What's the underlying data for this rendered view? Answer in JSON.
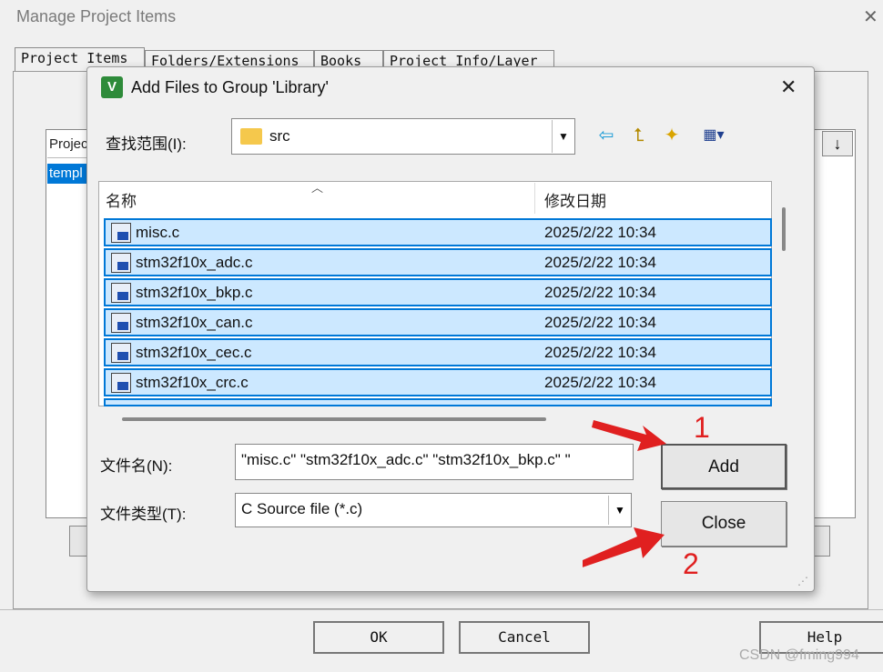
{
  "background_window": {
    "title": "Manage Project Items",
    "tabs": [
      "Project Items",
      "Folders/Extensions",
      "Books",
      "Project Info/Layer"
    ],
    "list_header": "Projec",
    "list_selected": "templ",
    "buttons": {
      "ok": "OK",
      "cancel": "Cancel",
      "help": "Help"
    }
  },
  "dialog": {
    "title": "Add Files to Group 'Library'",
    "icon_letter": "V",
    "look_in_label": "查找范围(I):",
    "look_in_value": "src",
    "columns": {
      "name": "名称",
      "date": "修改日期"
    },
    "files": [
      {
        "name": "misc.c",
        "date": "2025/2/22 10:34"
      },
      {
        "name": "stm32f10x_adc.c",
        "date": "2025/2/22 10:34"
      },
      {
        "name": "stm32f10x_bkp.c",
        "date": "2025/2/22 10:34"
      },
      {
        "name": "stm32f10x_can.c",
        "date": "2025/2/22 10:34"
      },
      {
        "name": "stm32f10x_cec.c",
        "date": "2025/2/22 10:34"
      },
      {
        "name": "stm32f10x_crc.c",
        "date": "2025/2/22 10:34"
      },
      {
        "name": "",
        "date": ""
      }
    ],
    "filename_label": "文件名(N):",
    "filename_value": "\"misc.c\" \"stm32f10x_adc.c\" \"stm32f10x_bkp.c\" \"",
    "filetype_label": "文件类型(T):",
    "filetype_value": "C Source file (*.c)",
    "add_label": "Add",
    "close_label": "Close"
  },
  "annotations": {
    "step1": "1",
    "step2": "2",
    "color": "#e02020"
  },
  "watermark": "CSDN @fming994",
  "colors": {
    "selection_bg": "#cce8ff",
    "selection_border": "#0078d7"
  }
}
